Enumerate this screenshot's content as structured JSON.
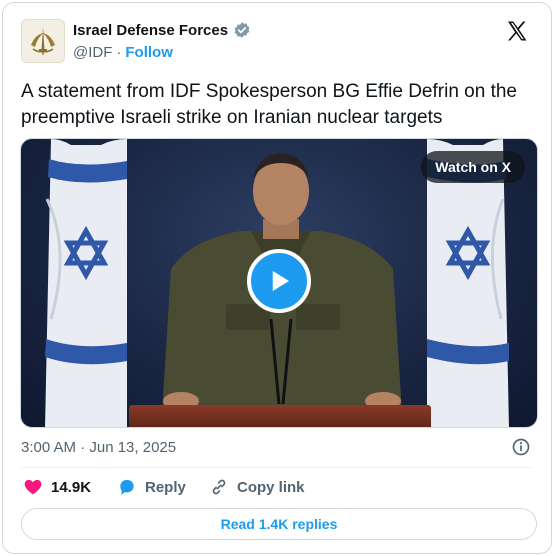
{
  "author": {
    "display_name": "Israel Defense Forces",
    "handle": "@IDF",
    "separator": "·",
    "follow_label": "Follow",
    "verified": true
  },
  "tweet": {
    "text": "A statement from IDF Spokesperson BG Effie Defrin on the preemptive Israeli strike on Iranian nuclear targets",
    "timestamp": "3:00 AM · Jun 13, 2025"
  },
  "media": {
    "type": "video",
    "watch_label": "Watch on X"
  },
  "actions": {
    "like_count": "14.9K",
    "reply_label": "Reply",
    "copy_label": "Copy link"
  },
  "read_replies_label": "Read 1.4K replies",
  "colors": {
    "accent": "#1d9bf0",
    "like": "#f91880",
    "text": "#0f1419",
    "muted": "#536471",
    "border": "#cfd9de"
  },
  "icons": [
    "idf-emblem-icon",
    "verified-badge-icon",
    "x-logo-icon",
    "play-icon",
    "info-icon",
    "heart-icon",
    "reply-bubble-icon",
    "link-icon"
  ]
}
